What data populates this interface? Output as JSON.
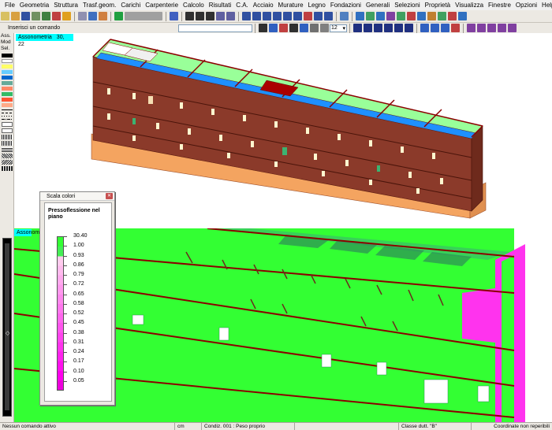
{
  "menu": [
    "File",
    "Geometria",
    "Struttura",
    "Trasf.geom.",
    "Carichi",
    "Carpenterie",
    "Calcolo",
    "Risultati",
    "C.A.",
    "Acciaio",
    "Murature",
    "Legno",
    "Fondazioni",
    "Generali",
    "Selezioni",
    "Proprietà",
    "Visualizza",
    "Finestre",
    "Opzioni",
    "Help"
  ],
  "toolbar": {
    "command_label": "Inserisci un comando",
    "command_value": "",
    "zoom_value": "12"
  },
  "palette": {
    "labels": [
      "Ass.",
      "Mod",
      "Sel."
    ],
    "swatches": [
      "#000000",
      "#ffffff",
      "#ffff66",
      "#66ccff",
      "#0066cc",
      "#66aa99",
      "#ff8866",
      "#33bb66",
      "#ff5533",
      "#ffaa88"
    ]
  },
  "views": {
    "top": {
      "tag": "Assonometria",
      "angles": "30, 22"
    },
    "bottom": {
      "tag": "Assonometria"
    }
  },
  "legend": {
    "window_title": "Scala colori",
    "heading": "Pressoflessione nel piano",
    "entries": [
      {
        "label": "30.40",
        "color": "#33ff33"
      },
      {
        "label": "1.00",
        "color": "#44ee55"
      },
      {
        "label": "0.93",
        "color": "#ffccee"
      },
      {
        "label": "0.86",
        "color": "#ffbbee"
      },
      {
        "label": "0.79",
        "color": "#ffaaee"
      },
      {
        "label": "0.72",
        "color": "#ff99ee"
      },
      {
        "label": "0.65",
        "color": "#ff88ee"
      },
      {
        "label": "0.58",
        "color": "#ff77ee"
      },
      {
        "label": "0.52",
        "color": "#ff66ee"
      },
      {
        "label": "0.45",
        "color": "#ff55ee"
      },
      {
        "label": "0.38",
        "color": "#ff44ee"
      },
      {
        "label": "0.31",
        "color": "#ff33ee"
      },
      {
        "label": "0.24",
        "color": "#ff22ee"
      },
      {
        "label": "0.17",
        "color": "#ff11ee"
      },
      {
        "label": "0.10",
        "color": "#ff00ee"
      },
      {
        "label": "0.05",
        "color": "#ee00dd"
      }
    ]
  },
  "status": {
    "message": "Nessun comando attivo",
    "unit": "cm",
    "condition": "Condiz. 001 : Peso proprio",
    "ductility": "Classe dutt. \"B\"",
    "coords": "Coordinate non reperibili"
  },
  "colors": {
    "accent": "#00ffff",
    "wall": "#8b3a2a",
    "slab_green": "#99ff99",
    "slab_blue": "#1e90ff",
    "foundation": "#f4a460",
    "result_green": "#33ff33",
    "result_magenta": "#ff33ee"
  }
}
